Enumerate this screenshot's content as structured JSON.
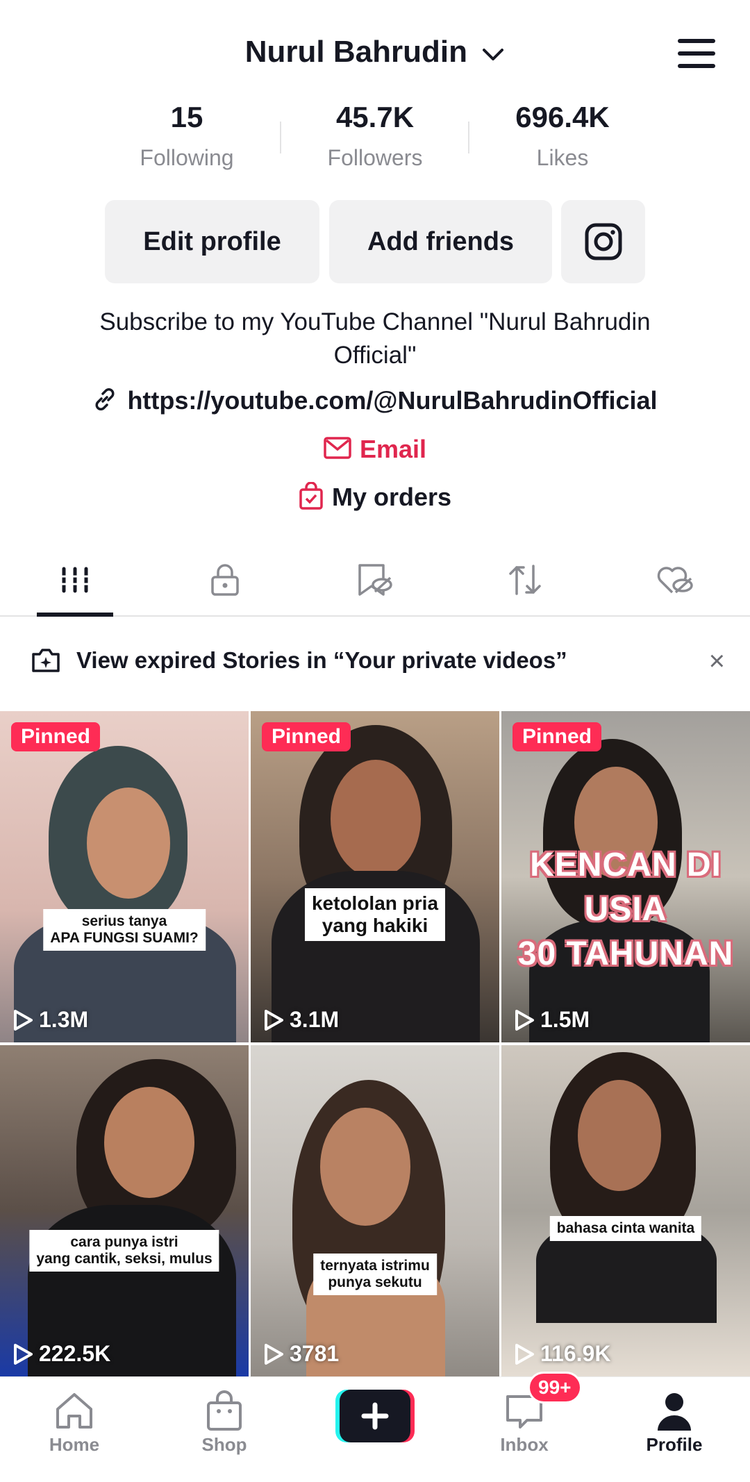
{
  "profile": {
    "username": "Nurul Bahrudin",
    "stats": [
      {
        "value": "15",
        "label": "Following"
      },
      {
        "value": "45.7K",
        "label": "Followers"
      },
      {
        "value": "696.4K",
        "label": "Likes"
      }
    ],
    "buttons": {
      "edit": "Edit profile",
      "add_friends": "Add friends"
    },
    "bio": "Subscribe to my YouTube Channel \"Nurul Bahrudin Official\"",
    "link": "https://youtube.com/@NurulBahrudinOfficial",
    "email": "Email",
    "orders": "My orders"
  },
  "banner": {
    "text": "View expired Stories in “Your private videos”",
    "close": "×"
  },
  "videos": [
    {
      "pinned": "Pinned",
      "views": "1.3M",
      "caption": "serius tanya\nAPA FUNGSI SUAMI?"
    },
    {
      "pinned": "Pinned",
      "views": "3.1M",
      "caption": "ketololan pria\nyang hakiki"
    },
    {
      "pinned": "Pinned",
      "views": "1.5M",
      "caption": "KENCAN DI USIA\n30 TAHUNAN"
    },
    {
      "views": "222.5K",
      "caption": "cara punya istri\nyang cantik, seksi, mulus"
    },
    {
      "views": "3781",
      "caption": "ternyata istrimu\npunya sekutu"
    },
    {
      "views": "116.9K",
      "caption": "bahasa cinta wanita"
    }
  ],
  "nav": {
    "home": "Home",
    "shop": "Shop",
    "inbox": "Inbox",
    "inbox_badge": "99+",
    "profile": "Profile"
  },
  "colors": {
    "accent": "#fe2c55",
    "email": "#e0264e",
    "text": "#161823",
    "muted": "#8a8b91"
  }
}
